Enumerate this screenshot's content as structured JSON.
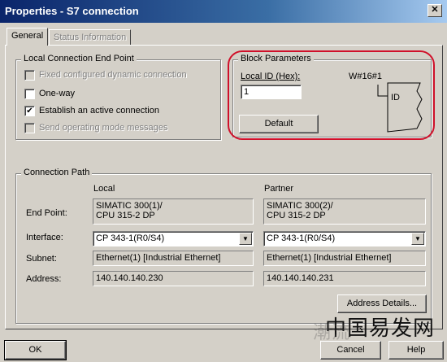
{
  "window": {
    "title": "Properties - S7 connection",
    "close_glyph": "✕"
  },
  "tabs": [
    {
      "label": "General",
      "active": true
    },
    {
      "label": "Status Information",
      "active": false
    }
  ],
  "local_endpoint": {
    "legend": "Local Connection End Point",
    "options": [
      {
        "label": "Fixed configured dynamic connection",
        "checked": false,
        "enabled": false
      },
      {
        "label": "One-way",
        "checked": false,
        "enabled": true
      },
      {
        "label": "Establish an active connection",
        "checked": true,
        "enabled": true
      },
      {
        "label": "Send operating mode messages",
        "checked": false,
        "enabled": false
      }
    ]
  },
  "block_params": {
    "legend": "Block Parameters",
    "local_id_label": "Local ID (Hex):",
    "local_id_value": "1",
    "w_label": "W#16#1",
    "id_label": "ID",
    "default_button": "Default"
  },
  "connection_path": {
    "legend": "Connection Path",
    "col_local": "Local",
    "col_partner": "Partner",
    "rows": {
      "end_point": "End Point:",
      "interface": "Interface:",
      "subnet": "Subnet:",
      "address": "Address:"
    },
    "local": {
      "end_point_1": "SIMATIC 300(1)/",
      "end_point_2": "CPU 315-2 DP",
      "interface": "CP 343-1(R0/S4)",
      "subnet": "Ethernet(1) [Industrial Ethernet]",
      "address": "140.140.140.230"
    },
    "partner": {
      "end_point_1": "SIMATIC 300(2)/",
      "end_point_2": "CPU 315-2 DP",
      "interface": "CP 343-1(R0/S4)",
      "subnet": "Ethernet(1) [Industrial Ethernet]",
      "address": "140.140.140.231"
    },
    "address_details_button": "Address Details..."
  },
  "footer": {
    "ok": "OK",
    "cancel": "Cancel",
    "help": "Help"
  },
  "watermark": {
    "text": "中国易发网",
    "ghost": "潮流"
  },
  "colors": {
    "titlebar": "#0a246a",
    "highlight": "#d0102a"
  }
}
